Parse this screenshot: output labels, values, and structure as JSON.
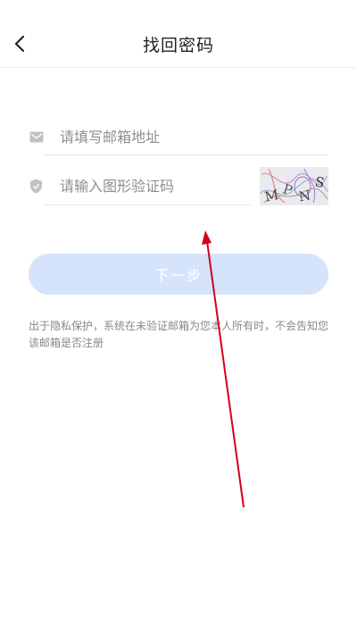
{
  "header": {
    "title": "找回密码",
    "back_icon": "chevron-left-icon"
  },
  "form": {
    "email": {
      "placeholder": "请填写邮箱地址",
      "icon": "mail-icon"
    },
    "captcha": {
      "placeholder": "请输入图形验证码",
      "icon": "shield-check-icon",
      "image_text": "MPNS"
    },
    "next_label": "下一步"
  },
  "notice": "出于隐私保护，系统在未验证邮箱为您本人所有时，不会告知您该邮箱是否注册",
  "colors": {
    "button_bg": "#d6e4fb",
    "annotation_arrow": "#d0021b",
    "icon_gray": "#c2c2c2"
  }
}
